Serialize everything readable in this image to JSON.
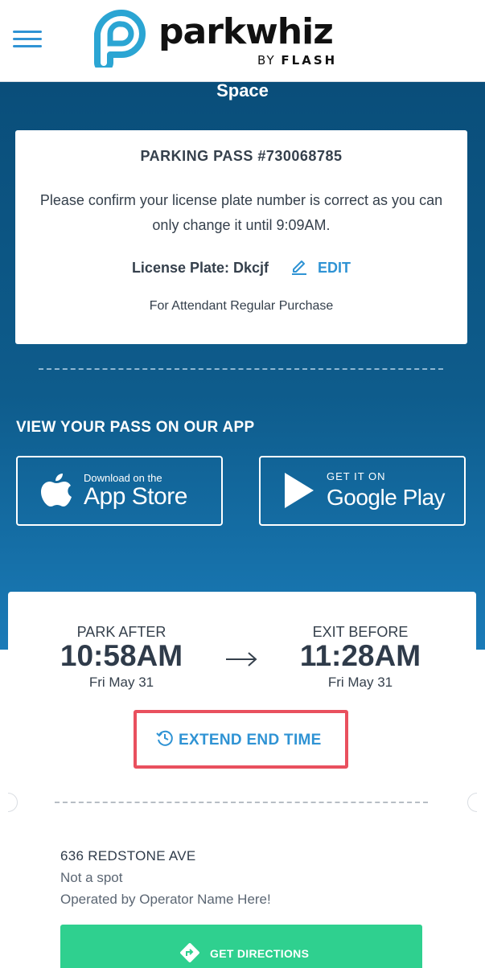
{
  "header": {
    "brand_name": "parkwhiz",
    "brand_sub_prefix": "BY ",
    "brand_sub_name": "FLASH",
    "menu_icon": "hamburger-icon",
    "logo_icon": "parkwhiz-logo-icon"
  },
  "page": {
    "title": "Space"
  },
  "pass": {
    "number": "PARKING PASS #730068785",
    "message": "Please confirm your license plate number is correct as you can only change it until 9:09AM.",
    "plate_label": "License Plate: Dkcjf",
    "edit_label": "EDIT",
    "edit_icon": "pencil-icon",
    "attendant_note": "For Attendant Regular Purchase"
  },
  "app_promo": {
    "heading": "VIEW YOUR PASS ON OUR APP",
    "apple": {
      "small": "Download on the",
      "big": "App Store",
      "icon": "apple-icon"
    },
    "google": {
      "small": "GET IT ON",
      "big": "Google Play",
      "icon": "google-play-icon"
    }
  },
  "times": {
    "start": {
      "label": "PARK AFTER",
      "time": "10:58AM",
      "date": "Fri May 31"
    },
    "end": {
      "label": "EXIT BEFORE",
      "time": "11:28AM",
      "date": "Fri May 31"
    },
    "arrow_icon": "arrow-right-icon",
    "extend_label": "EXTEND END TIME",
    "extend_icon": "clock-icon"
  },
  "location": {
    "address": "636 REDSTONE AVE",
    "spot": "Not a spot",
    "operator": "Operated by Operator Name Here!",
    "directions_label": "GET DIRECTIONS",
    "directions_icon": "directions-icon"
  },
  "colors": {
    "accent_blue": "#2f93d4",
    "header_bg": "#ffffff",
    "banner_blue": "#0e5c8c",
    "highlight_red": "#e9505e",
    "directions_green": "#2fd08f"
  }
}
